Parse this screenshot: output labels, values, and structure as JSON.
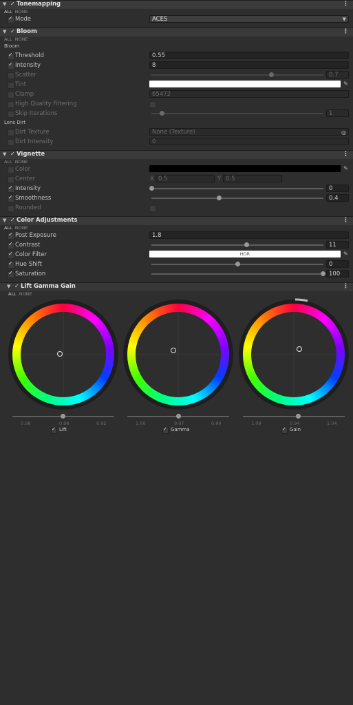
{
  "tonemapping": {
    "title": "Tonemapping",
    "all": "ALL",
    "none": "NONE",
    "mode_label": "Mode",
    "mode_value": "ACES"
  },
  "bloom": {
    "title": "Bloom",
    "all": "ALL",
    "none": "NONE",
    "section_bloom": "Bloom",
    "threshold_label": "Threshold",
    "threshold_value": "0.55",
    "intensity_label": "Intensity",
    "intensity_value": "8",
    "scatter_label": "Scatter",
    "scatter_value": "0.7",
    "scatter_level": 0.7,
    "tint_label": "Tint",
    "clamp_label": "Clamp",
    "clamp_value": "65472",
    "hq_label": "High Quality Filtering",
    "skip_label": "Skip Iterations",
    "skip_value": "1",
    "skip_level": 0.06,
    "section_dirt": "Lens Dirt",
    "dirt_texture_label": "Dirt Texture",
    "dirt_texture_value": "None (Texture)",
    "dirt_intensity_label": "Dirt Intensity",
    "dirt_intensity_value": "0"
  },
  "vignette": {
    "title": "Vignette",
    "all": "ALL",
    "none": "NONE",
    "color_label": "Color",
    "center_label": "Center",
    "center_x_label": "X",
    "center_x": "0.5",
    "center_y_label": "Y",
    "center_y": "0.5",
    "intensity_label": "Intensity",
    "intensity_value": "0",
    "intensity_level": 0.0,
    "smoothness_label": "Smoothness",
    "smoothness_value": "0.4",
    "smoothness_level": 0.4,
    "rounded_label": "Rounded"
  },
  "color_adjustments": {
    "title": "Color Adjustments",
    "all": "ALL",
    "none": "NONE",
    "post_exposure_label": "Post Exposure",
    "post_exposure_value": "1.8",
    "contrast_label": "Contrast",
    "contrast_value": "11",
    "contrast_level": 0.555,
    "color_filter_label": "Color Filter",
    "color_filter_badge": "HDR",
    "hue_shift_label": "Hue Shift",
    "hue_shift_value": "0",
    "hue_shift_level": 0.5,
    "saturation_label": "Saturation",
    "saturation_value": "100",
    "saturation_level": 1.0
  },
  "lgg": {
    "title": "Lift Gamma Gain",
    "all": "ALL",
    "none": "NONE",
    "wheels": [
      {
        "label": "Lift",
        "r": "0.98",
        "g": "0.98",
        "b": "0.92"
      },
      {
        "label": "Gamma",
        "r": "1.00",
        "g": "0.97",
        "b": "0.89"
      },
      {
        "label": "Gain",
        "r": "1.08",
        "g": "0.94",
        "b": "1.04"
      }
    ]
  },
  "colors": {
    "panel_bg": "#2e2e2e",
    "header_bg": "#3a3a3a",
    "field_bg": "#232323",
    "tint": "#ffffff",
    "vignette_color": "#000000",
    "color_filter": "#ffffff"
  },
  "icons": {
    "foldout": "triangle-down-icon",
    "menu": "vertical-dots-icon",
    "picker": "eyedropper-icon",
    "object_picker": "target-icon"
  }
}
